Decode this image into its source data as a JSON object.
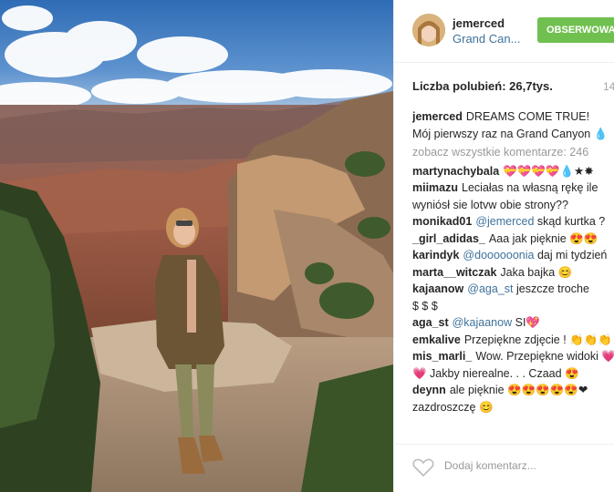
{
  "post": {
    "username": "jemerced",
    "location": "Grand Can...",
    "follow_label": "OBSERWOWA",
    "likes_text": "Liczba polubień: 26,7tys.",
    "time": "14"
  },
  "caption": {
    "user": "jemerced",
    "line1": "DREAMS COME TRUE!",
    "line2": "Mój pierwszy raz na Grand Canyon 💧"
  },
  "view_all": "zobacz wszystkie komentarze: 246",
  "comments": [
    {
      "user": "martynachybala",
      "mention": "",
      "text": "💝💝💝💝💧★✸"
    },
    {
      "user": "miimazu",
      "mention": "",
      "text": "Leciałas na własną rękę ile",
      "text2": "wyniósł sie lotvw obie strony??"
    },
    {
      "user": "monikad01",
      "mention": "@jemerced",
      "text": "skąd kurtka ?"
    },
    {
      "user": "_girl_adidas_",
      "mention": "",
      "text": "Aaa jak pięknie 😍😍"
    },
    {
      "user": "karindyk",
      "mention": "@doooooonia",
      "text": "daj mi tydzień"
    },
    {
      "user": "marta__witczak",
      "mention": "",
      "text": "Jaka bajka 😊"
    },
    {
      "user": "kajaanow",
      "mention": "@aga_st",
      "text": "jeszcze troche",
      "text2": "$ $ $"
    },
    {
      "user": "aga_st",
      "mention": "@kajaanow",
      "text": "SI💖"
    },
    {
      "user": "emkalive",
      "mention": "",
      "text": "Przepiękne zdjęcie ! 👏👏👏"
    },
    {
      "user": "mis_marli_",
      "mention": "",
      "text": "Wow. Przepiękne widoki 💗",
      "text2": "💗 Jakby nierealne. . . Czaad 😍"
    },
    {
      "user": "deynn",
      "mention": "",
      "text": "ale pięknie 😍😍😍😍😍❤",
      "text2": "zazdroszczę 😊"
    }
  ],
  "add_comment_placeholder": "Dodaj komentarz...",
  "icons": {
    "like": "heart-icon"
  }
}
